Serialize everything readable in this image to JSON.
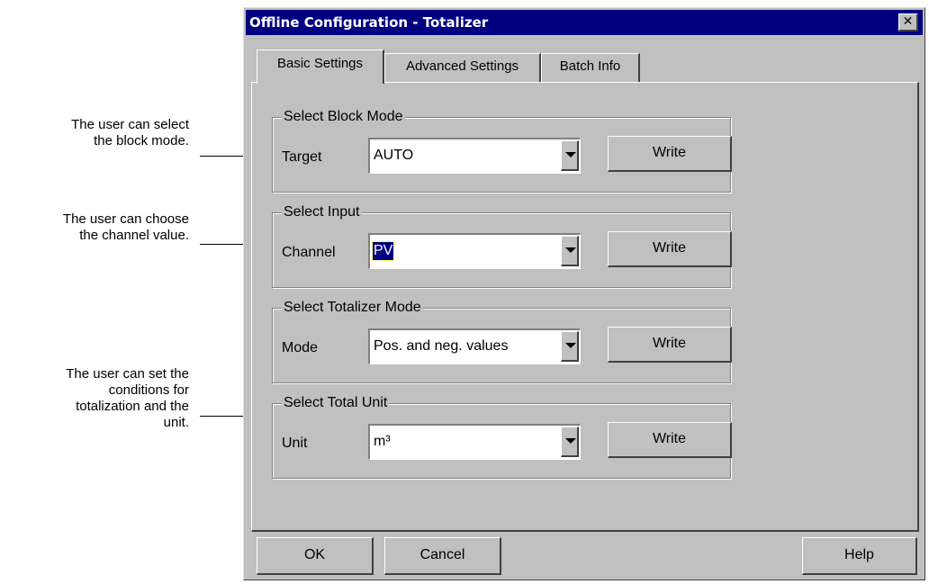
{
  "annotations": [
    {
      "lines": [
        "The user can select",
        "the block mode."
      ]
    },
    {
      "lines": [
        "The user can choose",
        "the channel value."
      ]
    },
    {
      "lines": [
        "The user can set the",
        "conditions for",
        "totalization and the",
        "unit."
      ]
    }
  ],
  "dialog": {
    "title": "Offline Configuration - Totalizer",
    "close_glyph": "✕",
    "tabs": [
      {
        "label": "Basic Settings",
        "active": true
      },
      {
        "label": "Advanced Settings",
        "active": false
      },
      {
        "label": "Batch Info",
        "active": false
      }
    ],
    "groups": [
      {
        "title": "Select Block Mode",
        "field_label": "Target",
        "value": "AUTO",
        "button": "Write"
      },
      {
        "title": "Select Input",
        "field_label": "Channel",
        "value": "PV",
        "button": "Write"
      },
      {
        "title": "Select Totalizer Mode",
        "field_label": "Mode",
        "value": "Pos. and neg. values",
        "button": "Write"
      },
      {
        "title": "Select Total Unit",
        "field_label": "Unit",
        "value": "m³",
        "button": "Write"
      }
    ],
    "buttons": {
      "ok": "OK",
      "cancel": "Cancel",
      "help": "Help"
    }
  }
}
